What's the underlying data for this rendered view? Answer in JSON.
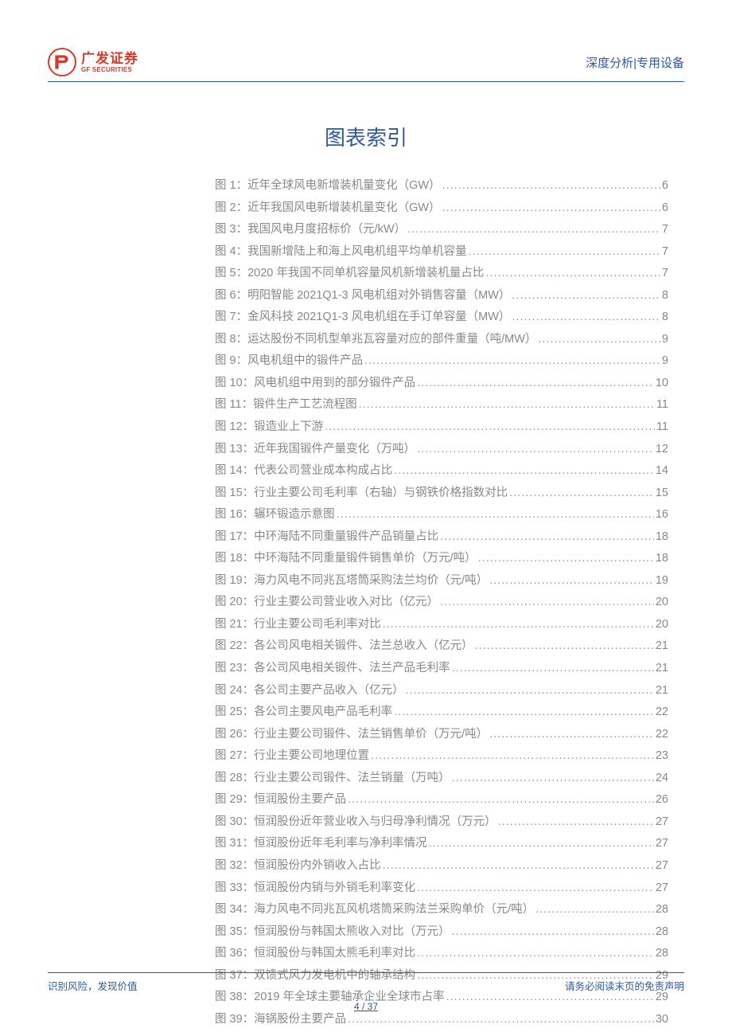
{
  "header": {
    "logo_cn": "广发证券",
    "logo_en": "GF SECURITIES",
    "category": "深度分析|专用设备"
  },
  "title": "图表索引",
  "toc": [
    {
      "label": "图 1：近年全球风电新增装机量变化（GW）",
      "page": "6"
    },
    {
      "label": "图 2：近年我国风电新增装机量变化（GW）",
      "page": "6"
    },
    {
      "label": "图 3：我国风电月度招标价（元/kW）",
      "page": "7"
    },
    {
      "label": "图 4：我国新增陆上和海上风电机组平均单机容量",
      "page": "7"
    },
    {
      "label": "图 5：2020 年我国不同单机容量风机新增装机量占比",
      "page": "7"
    },
    {
      "label": "图 6：明阳智能 2021Q1-3 风电机组对外销售容量（MW）",
      "page": "8"
    },
    {
      "label": "图 7：金风科技 2021Q1-3 风电机组在手订单容量（MW）",
      "page": "8"
    },
    {
      "label": "图 8：运达股份不同机型单兆瓦容量对应的部件重量（吨/MW）",
      "page": "9"
    },
    {
      "label": "图 9：风电机组中的锻件产品",
      "page": "9"
    },
    {
      "label": "图 10：风电机组中用到的部分锻件产品",
      "page": "10"
    },
    {
      "label": "图 11：锻件生产工艺流程图",
      "page": "11"
    },
    {
      "label": "图 12：锻造业上下游",
      "page": "11"
    },
    {
      "label": "图 13：近年我国锻件产量变化（万吨）",
      "page": "12"
    },
    {
      "label": "图 14：代表公司营业成本构成占比",
      "page": "14"
    },
    {
      "label": "图 15：行业主要公司毛利率（右轴）与钢铁价格指数对比",
      "page": "15"
    },
    {
      "label": "图 16：辗环锻造示意图",
      "page": "16"
    },
    {
      "label": "图 17：中环海陆不同重量锻件产品销量占比",
      "page": "18"
    },
    {
      "label": "图 18：中环海陆不同重量锻件销售单价（万元/吨）",
      "page": "18"
    },
    {
      "label": "图 19：海力风电不同兆瓦塔筒采购法兰均价（元/吨）",
      "page": "19"
    },
    {
      "label": "图 20：行业主要公司营业收入对比（亿元）",
      "page": "20"
    },
    {
      "label": "图 21：行业主要公司毛利率对比",
      "page": "20"
    },
    {
      "label": "图 22：各公司风电相关锻件、法兰总收入（亿元）",
      "page": "21"
    },
    {
      "label": "图 23：各公司风电相关锻件、法兰产品毛利率",
      "page": "21"
    },
    {
      "label": "图 24：各公司主要产品收入（亿元）",
      "page": "21"
    },
    {
      "label": "图 25：各公司主要风电产品毛利率",
      "page": "22"
    },
    {
      "label": "图 26：行业主要公司锻件、法兰销售单价（万元/吨）",
      "page": "22"
    },
    {
      "label": "图 27：行业主要公司地理位置",
      "page": "23"
    },
    {
      "label": "图 28：行业主要公司锻件、法兰销量（万吨）",
      "page": "24"
    },
    {
      "label": "图 29：恒润股份主要产品",
      "page": "26"
    },
    {
      "label": "图 30：恒润股份近年营业收入与归母净利情况（万元）",
      "page": "27"
    },
    {
      "label": "图 31：恒润股份近年毛利率与净利率情况",
      "page": "27"
    },
    {
      "label": "图 32：恒润股份内外销收入占比",
      "page": "27"
    },
    {
      "label": "图 33：恒润股份内销与外销毛利率变化",
      "page": "27"
    },
    {
      "label": "图 34：海力风电不同兆瓦风机塔筒采购法兰采购单价（元/吨）",
      "page": "28"
    },
    {
      "label": "图 35：恒润股份与韩国太熊收入对比（万元）",
      "page": "28"
    },
    {
      "label": "图 36：恒润股份与韩国太熊毛利率对比",
      "page": "28"
    },
    {
      "label": "图 37：双馈式风力发电机中的轴承结构",
      "page": "29"
    },
    {
      "label": "图 38：2019 年全球主要轴承企业全球市占率",
      "page": "29"
    },
    {
      "label": "图 39：海锅股份主要产品",
      "page": "30"
    }
  ],
  "footer": {
    "left": "识别风险，发现价值",
    "right": "请务必阅读末页的免责声明",
    "page": "4 / 37"
  }
}
